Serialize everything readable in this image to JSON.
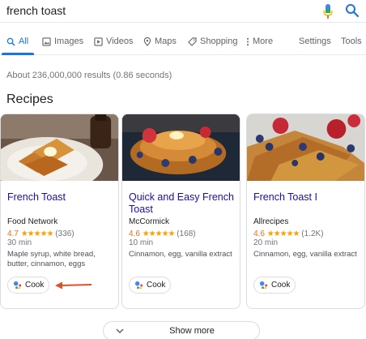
{
  "search": {
    "query": "french toast"
  },
  "tabs": [
    {
      "label": "All",
      "icon": "search-icon",
      "active": true
    },
    {
      "label": "Images",
      "icon": "image-icon"
    },
    {
      "label": "Videos",
      "icon": "video-icon"
    },
    {
      "label": "Maps",
      "icon": "map-pin-icon"
    },
    {
      "label": "Shopping",
      "icon": "tag-icon"
    },
    {
      "label": "More",
      "icon": "more-vert-icon"
    },
    {
      "label": "Settings"
    },
    {
      "label": "Tools"
    }
  ],
  "results": {
    "count_text": "About 236,000,000 results (0.86 seconds)"
  },
  "recipes": {
    "section_title": "Recipes",
    "cards": [
      {
        "title": "French Toast",
        "source": "Food Network",
        "rating": "4.7",
        "stars": "★★★★★",
        "reviews": "(336)",
        "time": "30 min",
        "ingredients": "Maple syrup, white bread, butter, cinnamon, eggs",
        "button": "Cook"
      },
      {
        "title": "Quick and Easy French Toast",
        "source": "McCormick",
        "rating": "4.6",
        "stars": "★★★★★",
        "reviews": "(168)",
        "time": "10 min",
        "ingredients": "Cinnamon, egg, vanilla extract",
        "button": "Cook"
      },
      {
        "title": "French Toast I",
        "source": "Allrecipes",
        "rating": "4.6",
        "stars": "★★★★★",
        "reviews": "(1.2K)",
        "time": "20 min",
        "ingredients": "Cinnamon, egg, vanilla extract",
        "button": "Cook"
      }
    ]
  },
  "show_more": {
    "label": "Show more"
  },
  "colors": {
    "link": "#1a0dab",
    "accent": "#1a73e8",
    "rating": "#e7711b",
    "stars": "#f6a200",
    "annotation_arrow": "#d9532c"
  }
}
